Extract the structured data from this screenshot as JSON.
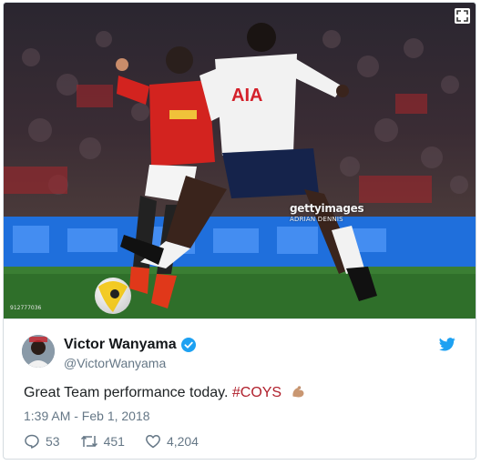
{
  "photo": {
    "watermark_brand": "gettyimages",
    "watermark_credit": "ADRIAN DENNIS",
    "image_id": "912777036",
    "ad_board_color": "#1e6ee0",
    "pitch_color": "#2f6f2a"
  },
  "tweet": {
    "display_name": "Victor Wanyama",
    "handle": "@VictorWanyama",
    "text_main": "Great Team performance today.",
    "hashtag": "#COYS",
    "emoji": "flexed-biceps",
    "timestamp": "1:39 AM - Feb 1, 2018",
    "replies": "53",
    "retweets": "451",
    "likes": "4,204",
    "colors": {
      "verified": "#1da1f2",
      "twitter_brand": "#1da1f2",
      "hashtag": "#b0202c",
      "secondary_text": "#657786"
    }
  }
}
